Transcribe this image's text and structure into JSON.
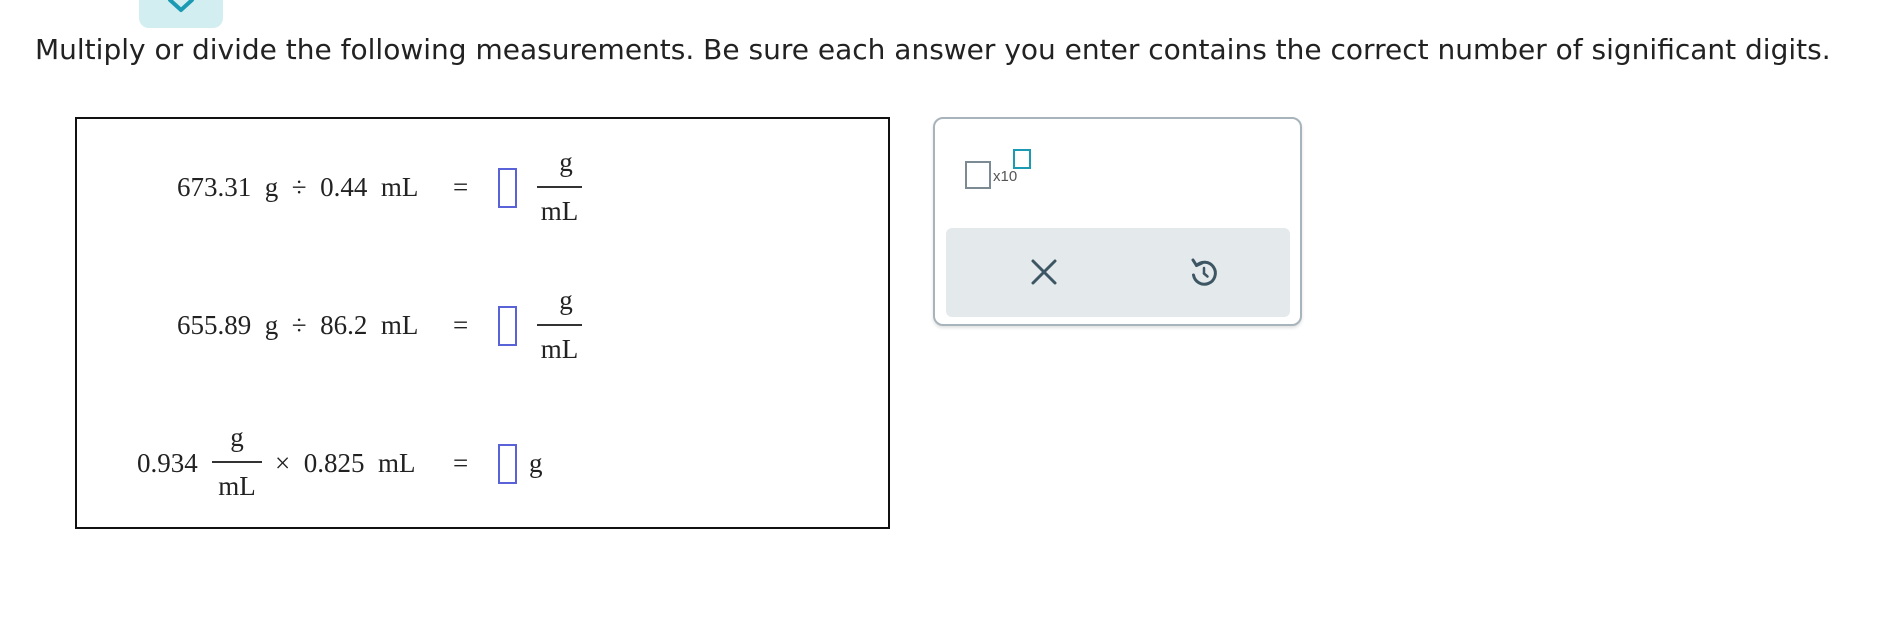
{
  "instructions": "Multiply or divide the following measurements. Be sure each answer you enter contains the correct number of significant digits.",
  "problems": [
    {
      "expression": "673.31  g  ÷  0.44  mL",
      "equals": "=",
      "answer_value": "",
      "unit_numerator": "g",
      "unit_denominator": "mL"
    },
    {
      "expression": "655.89  g  ÷  86.2  mL",
      "equals": "=",
      "answer_value": "",
      "unit_numerator": "g",
      "unit_denominator": "mL"
    },
    {
      "coefficient": "0.934",
      "coefficient_numerator": "g",
      "coefficient_denominator": "mL",
      "operation": "×  0.825  mL",
      "equals": "=",
      "answer_value": "",
      "unit": "g"
    }
  ],
  "toolbar": {
    "sci_notation_label": "x10"
  },
  "colors": {
    "answer_border": "#5a62d8",
    "exponent_border": "#1b9bb3",
    "toolbar_bg": "#e4e9ec",
    "icon": "#3d5663",
    "top_tab": "#d2eef1"
  },
  "icons": {
    "top_tab": "chevron-down-icon",
    "clear": "close-icon",
    "undo": "undo-icon"
  }
}
